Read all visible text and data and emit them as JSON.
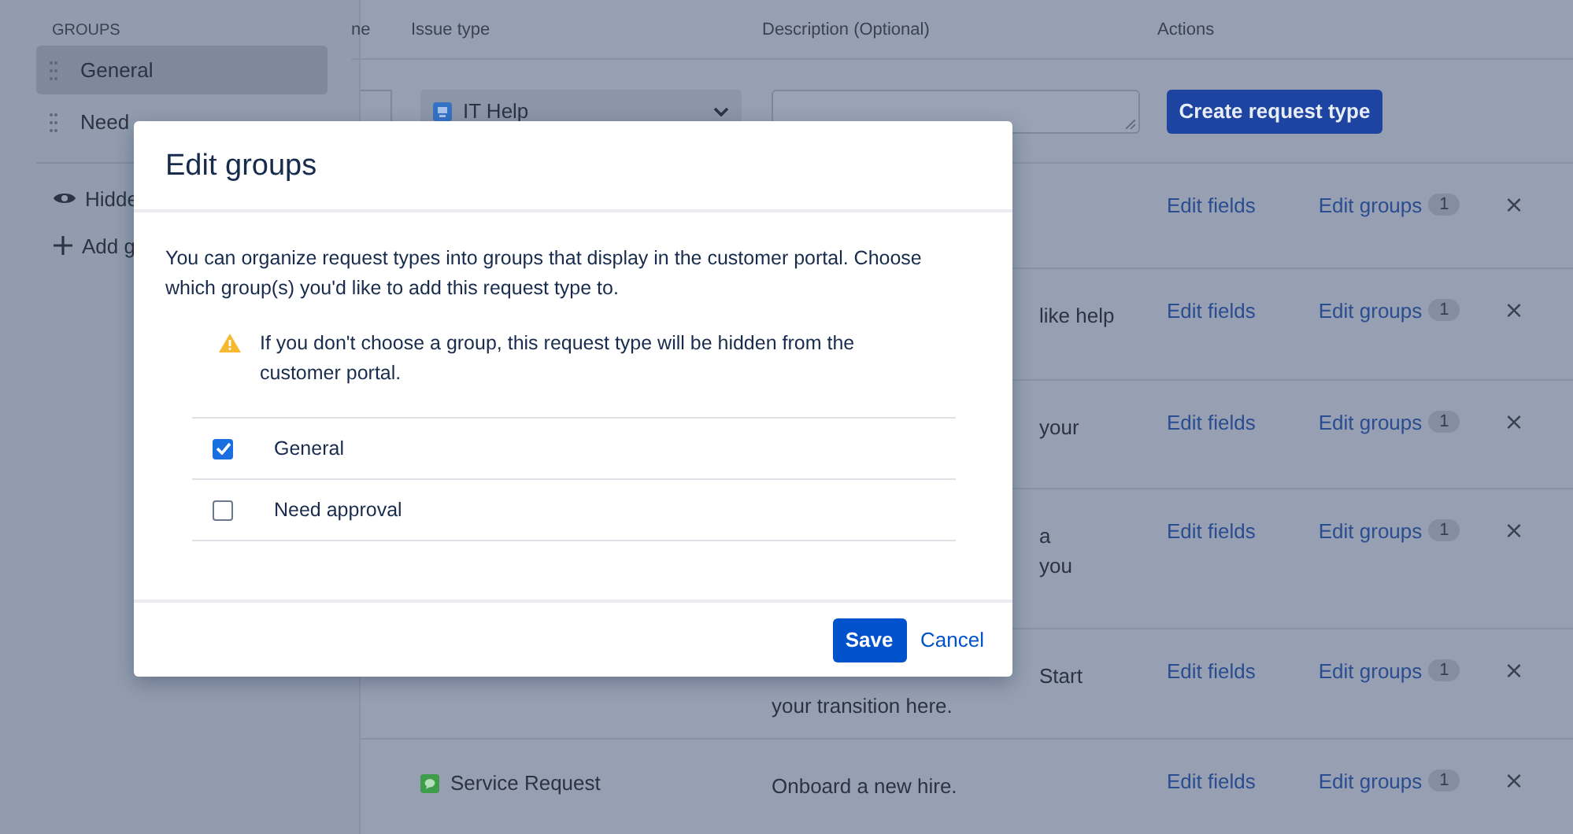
{
  "sidebar": {
    "heading": "GROUPS",
    "groups": [
      {
        "label": "General",
        "selected": true
      },
      {
        "label": "Need",
        "selected": false
      }
    ],
    "links": [
      {
        "kind": "hidden",
        "label": "Hidde"
      },
      {
        "kind": "add",
        "label": "Add g"
      }
    ]
  },
  "table": {
    "columns": [
      "ne",
      "Issue type",
      "Description (Optional)",
      "Actions"
    ],
    "create_row": {
      "issue_type": "IT Help",
      "button": "Create request type"
    },
    "rows": [
      {
        "description": [],
        "edit_fields": "Edit fields",
        "edit_groups": "Edit groups",
        "count": "1",
        "remove": "×"
      },
      {
        "description": [
          {
            "text": "like help",
            "behind_dialog": true
          }
        ],
        "edit_fields": "Edit fields",
        "edit_groups": "Edit groups",
        "count": "1",
        "remove": "×"
      },
      {
        "description": [
          {
            "text": "your",
            "behind_dialog": true
          }
        ],
        "edit_fields": "Edit fields",
        "edit_groups": "Edit groups",
        "count": "1",
        "remove": "×"
      },
      {
        "description": [
          {
            "text": "a",
            "behind_dialog": true
          },
          {
            "text": "you",
            "behind_dialog": true
          }
        ],
        "edit_fields": "Edit fields",
        "edit_groups": "Edit groups",
        "count": "1",
        "remove": "×"
      },
      {
        "description": [
          {
            "text": "Start",
            "behind_dialog": true
          },
          {
            "text": "your transition here.",
            "behind_dialog": false
          }
        ],
        "edit_fields": "Edit fields",
        "edit_groups": "Edit groups",
        "count": "1",
        "remove": "×"
      },
      {
        "issue_type": "Service Request",
        "description": [
          {
            "text": "Onboard a new hire.",
            "behind_dialog": false
          }
        ],
        "edit_fields": "Edit fields",
        "edit_groups": "Edit groups",
        "count": "1",
        "remove": "×"
      }
    ]
  },
  "dialog": {
    "title": "Edit groups",
    "intro": "You can organize request types into groups that display in the customer portal. Choose which group(s) you'd like to add this request type to.",
    "warning": "If you don't choose a group, this request type will be hidden from the customer portal.",
    "options": [
      {
        "label": "General",
        "checked": true
      },
      {
        "label": "Need approval",
        "checked": false
      }
    ],
    "save": "Save",
    "cancel": "Cancel"
  }
}
